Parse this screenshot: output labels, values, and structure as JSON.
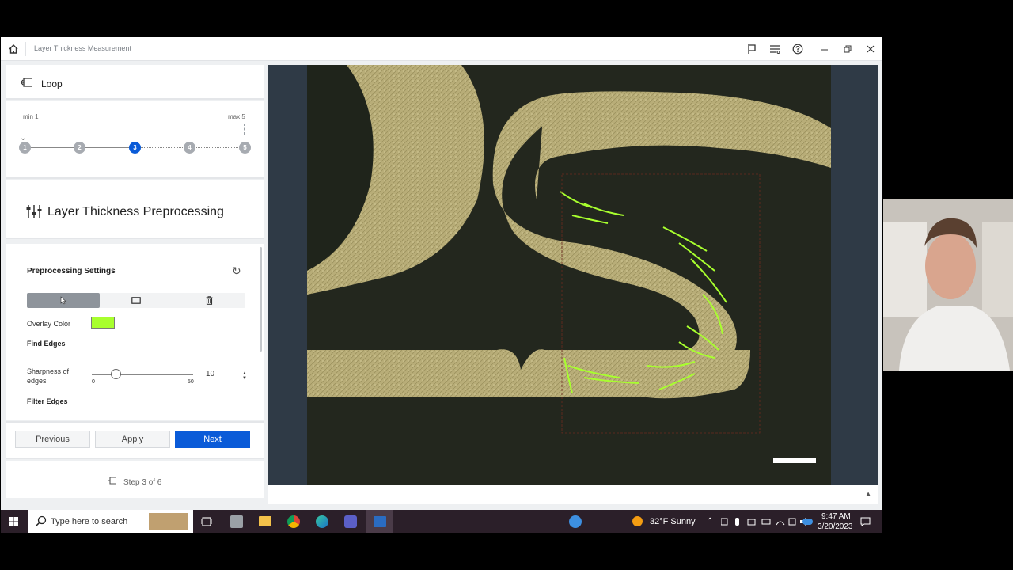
{
  "app": {
    "title": "Layer Thickness Measurement"
  },
  "loop": {
    "label": "Loop",
    "min_label": "min 1",
    "max_label": "max 5",
    "steps": [
      "1",
      "2",
      "3",
      "4",
      "5"
    ],
    "active_step": "3"
  },
  "section": {
    "title": "Layer Thickness Preprocessing"
  },
  "settings": {
    "heading": "Preprocessing Settings",
    "overlay_color_label": "Overlay Color",
    "overlay_color": "#a8ff2e",
    "find_edges_label": "Find Edges",
    "sharpness_label": "Sharpness of edges",
    "sharpness_min": "0",
    "sharpness_max": "50",
    "sharpness_value": "10",
    "filter_edges_label": "Filter Edges",
    "tools": [
      "pointer-icon",
      "rectangle-icon",
      "trash-icon"
    ]
  },
  "buttons": {
    "previous": "Previous",
    "apply": "Apply",
    "next": "Next"
  },
  "step_info": "Step 3 of 6",
  "taskbar": {
    "search_placeholder": "Type here to search",
    "weather": "32°F  Sunny",
    "time": "9:47 AM",
    "date": "3/20/2023"
  },
  "colors": {
    "accent": "#0a5bd8",
    "overlay": "#a8ff2e"
  }
}
